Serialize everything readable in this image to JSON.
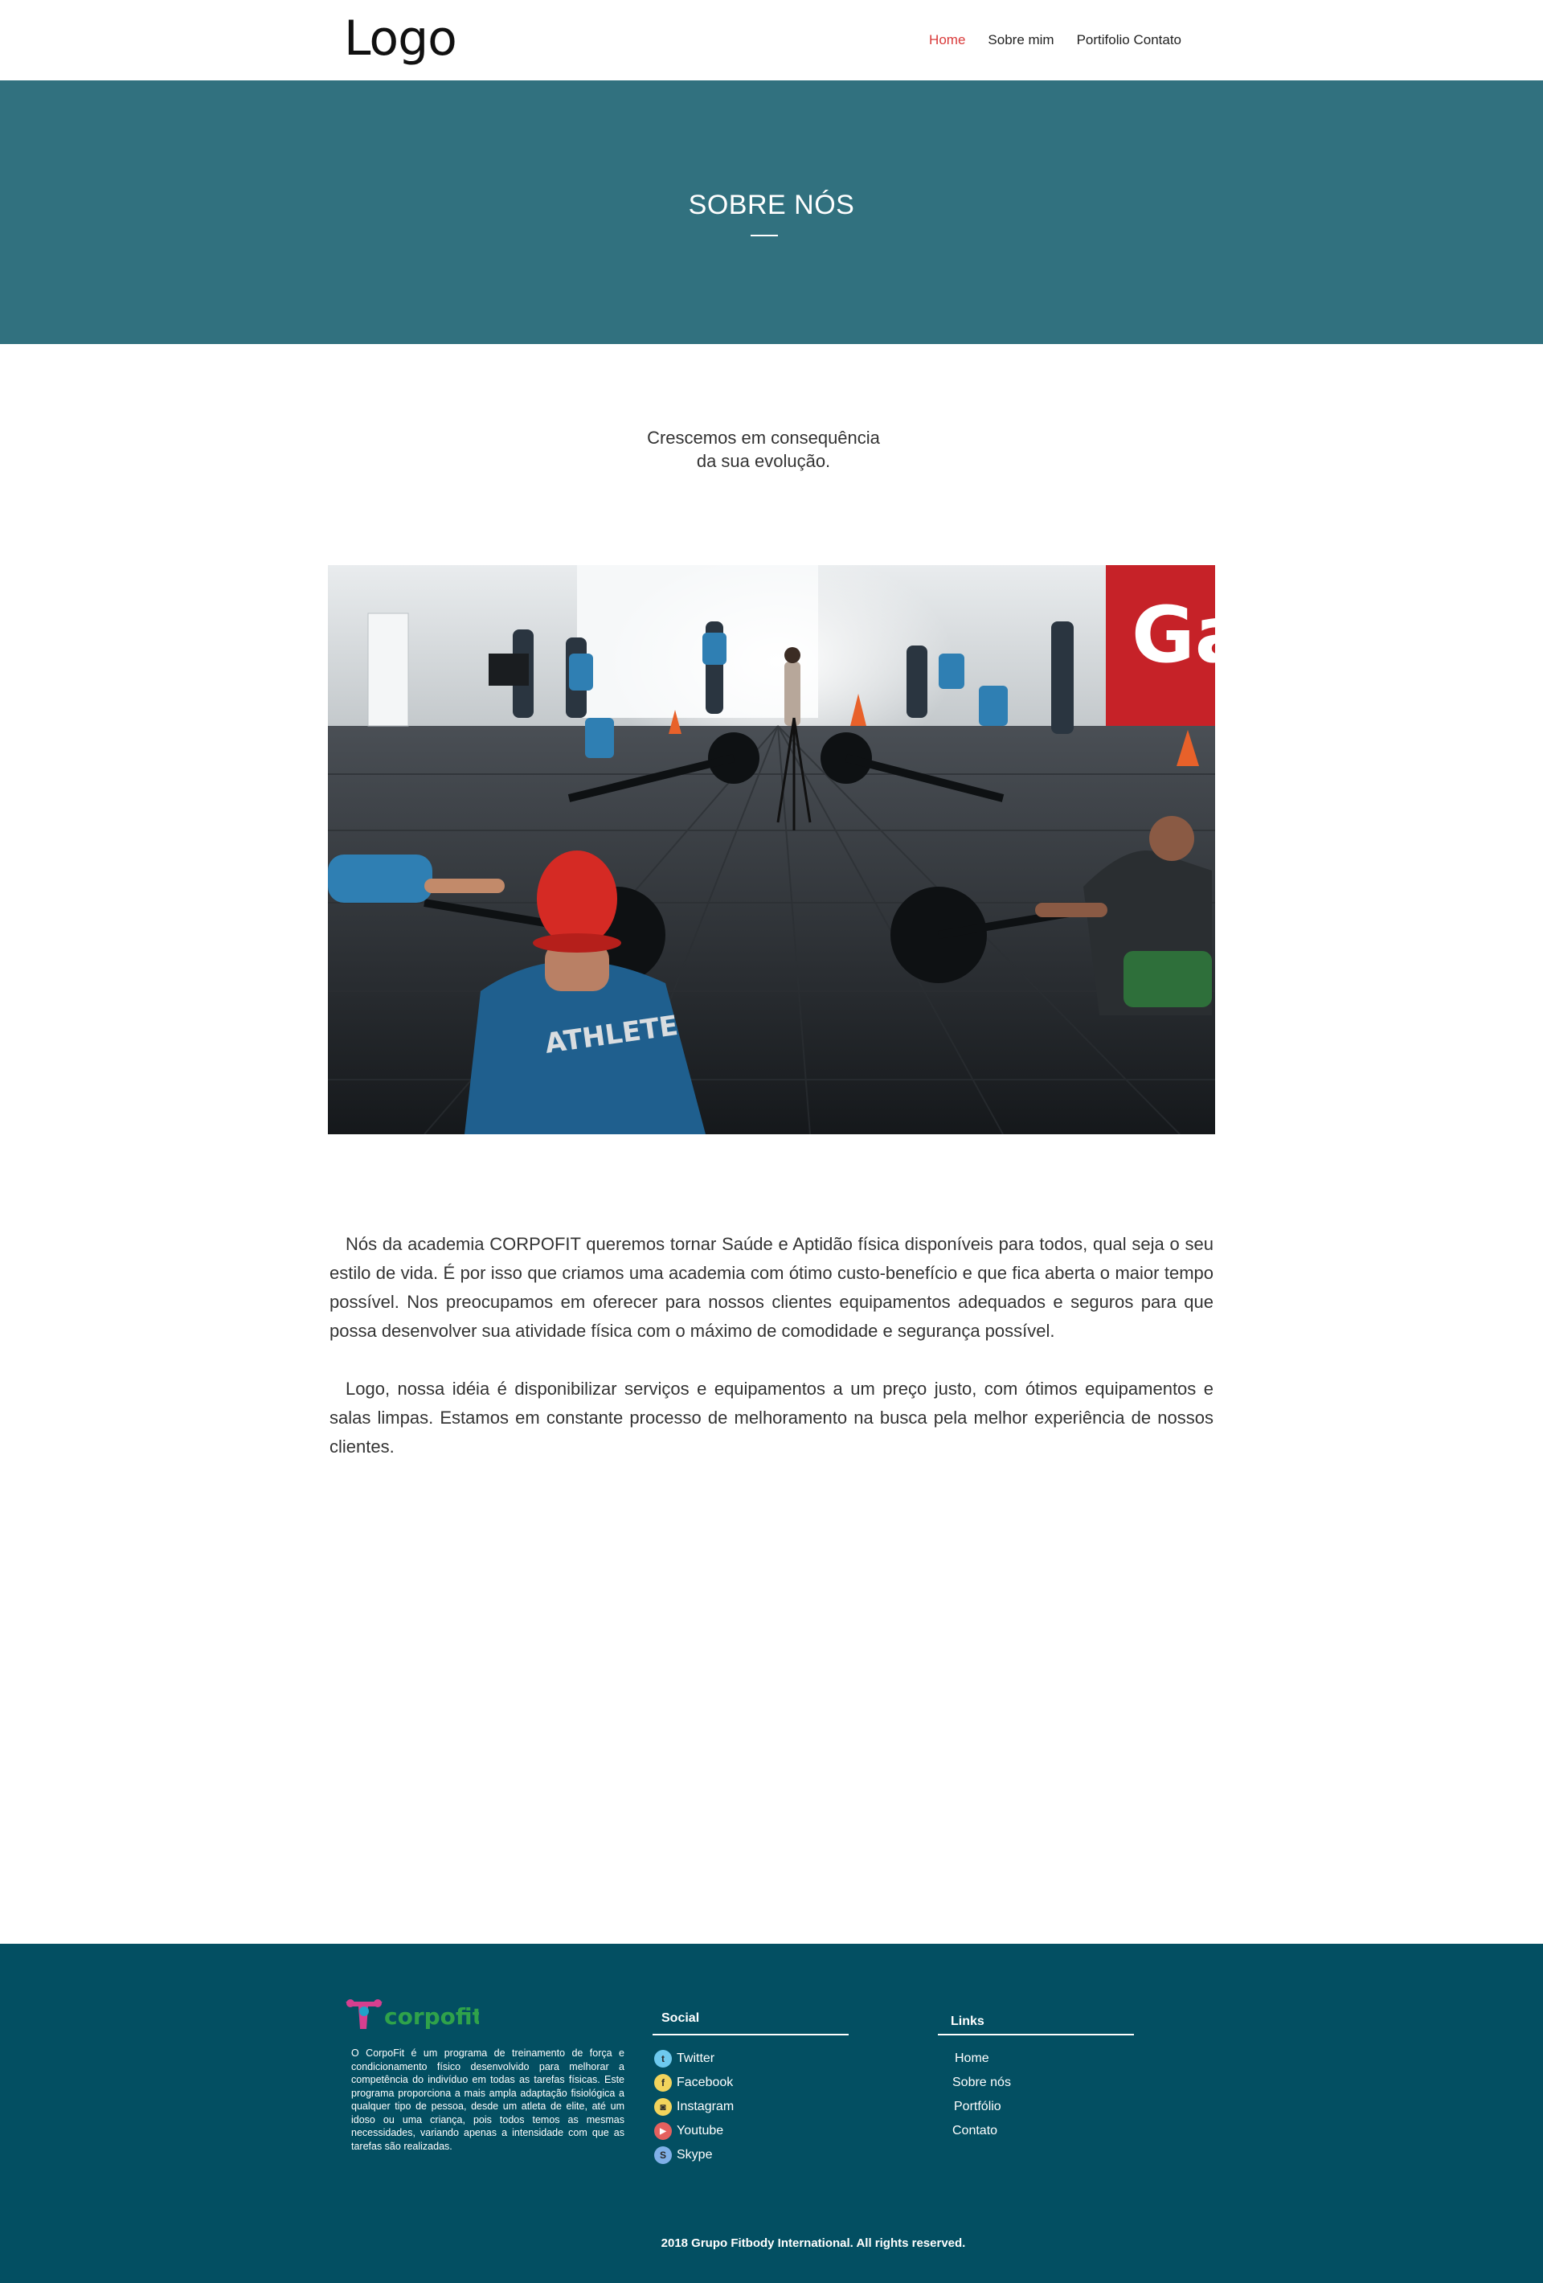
{
  "header": {
    "logo": "Logo",
    "nav": [
      "Home",
      "Sobre mim",
      "Portifolio Contato"
    ]
  },
  "hero": {
    "title": "SOBRE NÓS"
  },
  "tagline": {
    "line1": "Crescemos em consequência",
    "line2": "da sua evolução."
  },
  "photo": {
    "shirt_text": "ATHLETE",
    "wall_text": "Ga"
  },
  "body": {
    "p1": "Nós da academia CORPOFIT queremos tornar Saúde e Aptidão física disponíveis para todos, qual seja o seu estilo de vida. É por isso que criamos uma academia com ótimo custo-benefício e que fica aberta o maior tempo possível.  Nos preocupamos em oferecer para nossos clientes equipamentos adequados e seguros para que possa desenvolver sua atividade física com o máximo de comodidade e segurança possível.",
    "p2": "Logo, nossa idéia é disponibilizar serviços e equipamentos a um preço justo, com ótimos equipamentos e salas limpas. Estamos em constante processo de melhoramento na busca pela melhor experiência de nossos clientes."
  },
  "footer": {
    "brand": "corpofit",
    "about": "O CorpoFit é um programa de treinamento de força e condicionamento físico desenvolvido para melhorar a competência do indivíduo em todas as tarefas físicas. Este programa proporciona a mais ampla adaptação fisiológica a qualquer tipo de pessoa, desde um atleta de elite, até um idoso ou uma criança, pois todos temos as mesmas necessidades, variando apenas a intensidade com que as tarefas são realizadas.",
    "social_title": "Social",
    "social": [
      {
        "label": "Twitter",
        "icon": "twitter-icon",
        "glyph": "t",
        "color": "#6ec9ee"
      },
      {
        "label": "Facebook",
        "icon": "facebook-icon",
        "glyph": "f",
        "color": "#f2d45c"
      },
      {
        "label": "Instagram",
        "icon": "instagram-icon",
        "glyph": "◙",
        "color": "#f2d45c"
      },
      {
        "label": "Youtube",
        "icon": "youtube-icon",
        "glyph": "▶",
        "color": "#e4605e"
      },
      {
        "label": "Skype",
        "icon": "skype-icon",
        "glyph": "S",
        "color": "#7fb0e8"
      }
    ],
    "links_title": "Links",
    "links": [
      "Home",
      "Sobre nós",
      "Portfólio",
      "Contato"
    ],
    "copyright": "2018 Grupo Fitbody International. All rights reserved."
  },
  "colors": {
    "hero": "#31717f",
    "footer": "#034f62",
    "nav_active": "#d93a3a"
  }
}
